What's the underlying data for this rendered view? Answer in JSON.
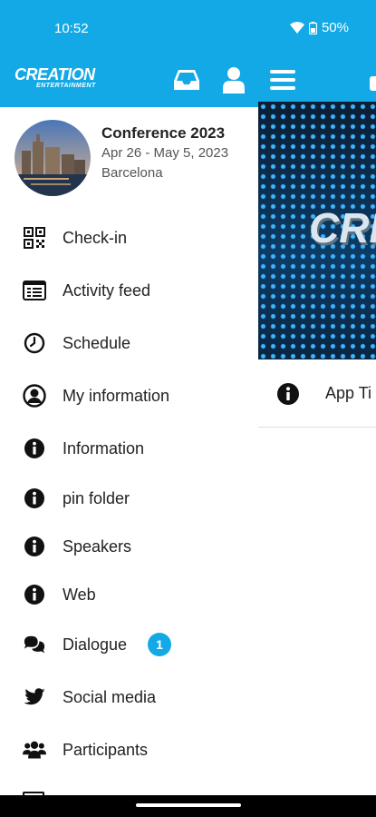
{
  "status": {
    "time": "10:52",
    "battery": "50%"
  },
  "header": {
    "logo_main": "CREATION",
    "logo_sub": "ENTERTAINMENT"
  },
  "event": {
    "title": "Conference 2023",
    "dates": "Apr 26 - May 5, 2023",
    "location": "Barcelona"
  },
  "background": {
    "banner_text": "CRE",
    "tip_label": "App Ti"
  },
  "menu": [
    {
      "label": "Check-in",
      "icon": "qr-code-icon"
    },
    {
      "label": "Activity feed",
      "icon": "feed-icon"
    },
    {
      "label": "Schedule",
      "icon": "clock-icon"
    },
    {
      "label": "My information",
      "icon": "user-circle-icon"
    },
    {
      "label": "Information",
      "icon": "info-icon"
    },
    {
      "label": "pin folder",
      "icon": "info-icon"
    },
    {
      "label": "Speakers",
      "icon": "info-icon"
    },
    {
      "label": "Web",
      "icon": "info-icon"
    },
    {
      "label": "Dialogue",
      "icon": "chat-icon",
      "badge": "1"
    },
    {
      "label": "Social media",
      "icon": "twitter-icon"
    },
    {
      "label": "Participants",
      "icon": "users-icon"
    }
  ],
  "colors": {
    "accent": "#13a9e6",
    "text": "#222222"
  }
}
